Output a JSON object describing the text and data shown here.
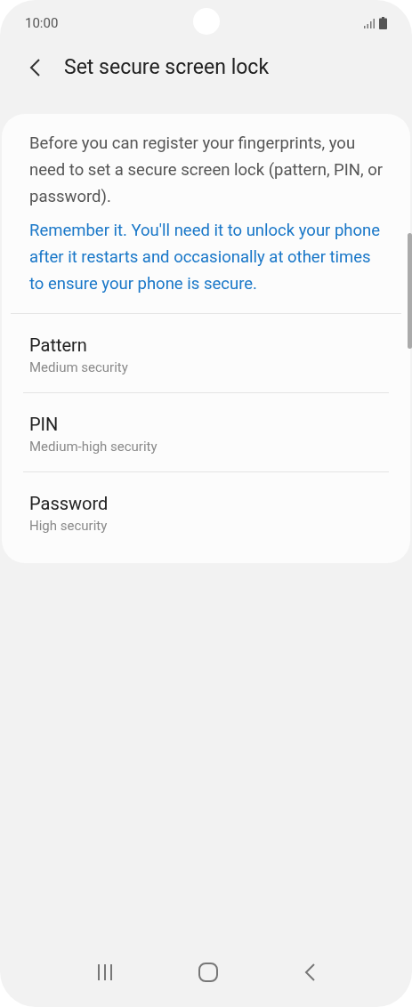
{
  "status_bar": {
    "time": "10:00"
  },
  "header": {
    "title": "Set secure screen lock"
  },
  "card": {
    "description": "Before you can register your fingerprints, you need to set a secure screen lock (pattern, PIN, or password).",
    "note": "Remember it. You'll need it to unlock your phone after it restarts and occasionally at other times to ensure your phone is secure.",
    "options": [
      {
        "title": "Pattern",
        "subtitle": "Medium security"
      },
      {
        "title": "PIN",
        "subtitle": "Medium-high security"
      },
      {
        "title": "Password",
        "subtitle": "High security"
      }
    ]
  }
}
